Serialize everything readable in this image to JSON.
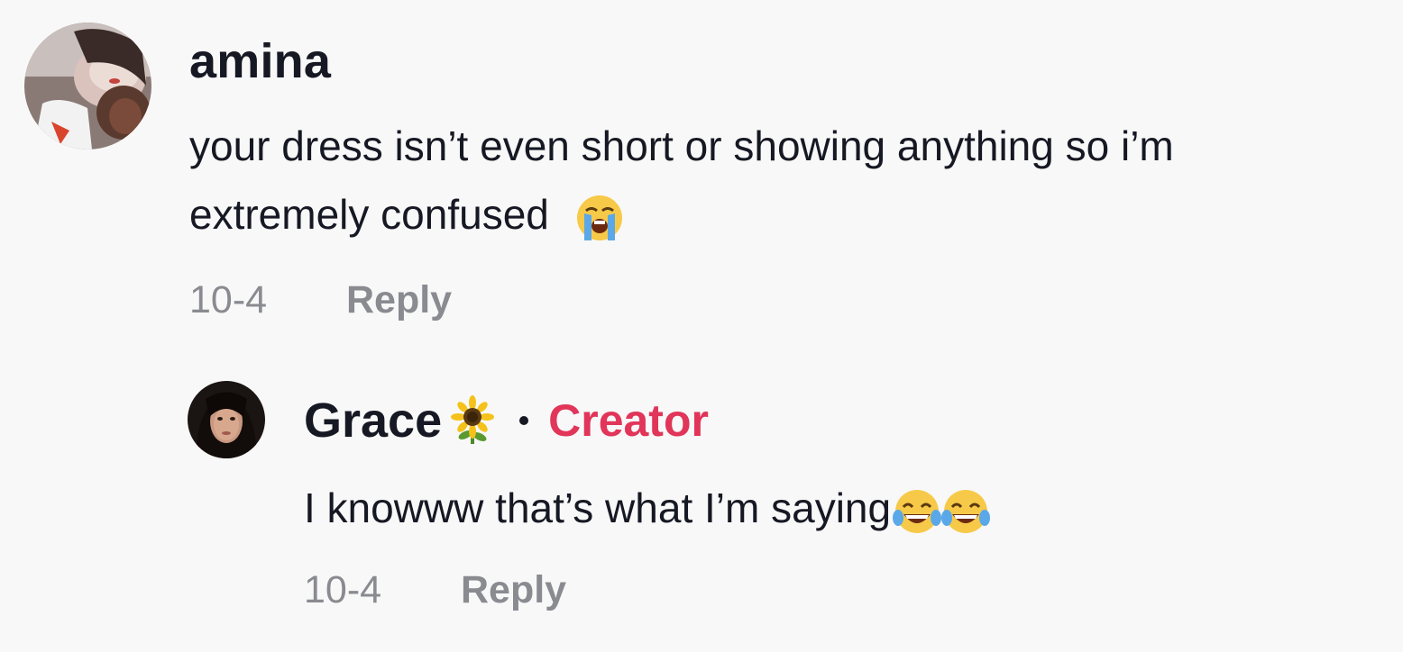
{
  "comments": [
    {
      "username": "amina",
      "text": "your dress isn’t even short or showing anything so i’m extremely confused",
      "text_line1": "your dress isn’t even short or showing anything so i’m",
      "text_line2": "extremely confused",
      "emoji": "loudly-crying-face",
      "date": "10-4",
      "reply_label": "Reply",
      "avatar": "profile-photo"
    }
  ],
  "replies": [
    {
      "username": "Grace",
      "name_emoji": "sunflower",
      "separator": "·",
      "badge": "Creator",
      "badge_color": "#e1355a",
      "text": "I knowww that’s what I’m saying",
      "emoji": [
        "face-with-tears-of-joy",
        "face-with-tears-of-joy"
      ],
      "date": "10-4",
      "reply_label": "Reply",
      "avatar": "profile-photo"
    }
  ],
  "colors": {
    "background": "#f8f8f8",
    "primary_text": "#161823",
    "secondary_text": "#8a8b91",
    "creator_accent": "#e1355a"
  }
}
